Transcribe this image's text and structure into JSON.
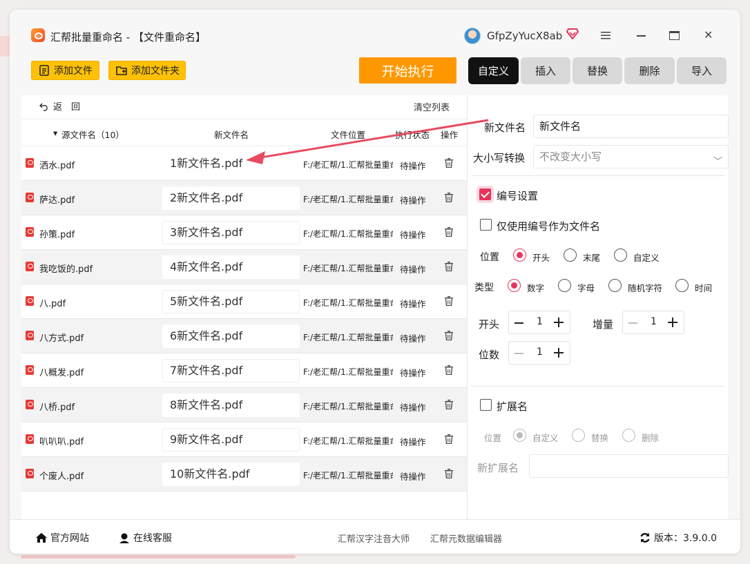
{
  "title": "汇帮批量重命名 - 【文件重命名】",
  "user": {
    "name": "GfpZyYucX8ab"
  },
  "toolbar": {
    "add_file": "添加文件",
    "add_folder": "添加文件夹",
    "start": "开始执行"
  },
  "tabs": [
    "自定义",
    "插入",
    "替换",
    "删除",
    "导入"
  ],
  "list": {
    "back": "返　回",
    "clear": "清空列表",
    "headers": {
      "source": "源文件名（10）",
      "new_name": "新文件名",
      "location": "文件位置",
      "status": "执行状态",
      "action": "操作"
    },
    "rows": [
      {
        "source": "洒水.pdf",
        "new_name": "1新文件名.pdf",
        "location": "F:/老汇帮/1.汇帮批量重命名",
        "status": "待操作"
      },
      {
        "source": "萨达.pdf",
        "new_name": "2新文件名.pdf",
        "location": "F:/老汇帮/1.汇帮批量重命名",
        "status": "待操作"
      },
      {
        "source": "孙策.pdf",
        "new_name": "3新文件名.pdf",
        "location": "F:/老汇帮/1.汇帮批量重命名",
        "status": "待操作"
      },
      {
        "source": "我吃饭的.pdf",
        "new_name": "4新文件名.pdf",
        "location": "F:/老汇帮/1.汇帮批量重命名",
        "status": "待操作"
      },
      {
        "source": "八.pdf",
        "new_name": "5新文件名.pdf",
        "location": "F:/老汇帮/1.汇帮批量重命名",
        "status": "待操作"
      },
      {
        "source": "八方式.pdf",
        "new_name": "6新文件名.pdf",
        "location": "F:/老汇帮/1.汇帮批量重命名",
        "status": "待操作"
      },
      {
        "source": "八概发.pdf",
        "new_name": "7新文件名.pdf",
        "location": "F:/老汇帮/1.汇帮批量重命名",
        "status": "待操作"
      },
      {
        "source": "八桥.pdf",
        "new_name": "8新文件名.pdf",
        "location": "F:/老汇帮/1.汇帮批量重命名",
        "status": "待操作"
      },
      {
        "source": "叭叭叭.pdf",
        "new_name": "9新文件名.pdf",
        "location": "F:/老汇帮/1.汇帮批量重命名",
        "status": "待操作"
      },
      {
        "source": "个废人.pdf",
        "new_name": "10新文件名.pdf",
        "location": "F:/老汇帮/1.汇帮批量重命名",
        "status": "待操作"
      }
    ]
  },
  "settings": {
    "new_name_label": "新文件名",
    "new_name_value": "新文件名",
    "case_label": "大小写转换",
    "case_value": "不改变大小写",
    "numbering_label": "编号设置",
    "numbering_checked": true,
    "only_number_label": "仅使用编号作为文件名",
    "only_number_checked": false,
    "position_label": "位置",
    "position_options": [
      "开头",
      "末尾",
      "自定义"
    ],
    "position_selected": 0,
    "type_label": "类型",
    "type_options": [
      "数字",
      "字母",
      "随机字符",
      "时间"
    ],
    "type_selected": 0,
    "start_label": "开头",
    "start_value": "1",
    "increment_label": "增量",
    "increment_value": "1",
    "digits_label": "位数",
    "digits_value": "1",
    "ext_label": "扩展名",
    "ext_checked": false,
    "ext_position_label": "位置",
    "ext_position_options": [
      "自定义",
      "替换",
      "删除"
    ],
    "ext_position_selected": 0,
    "new_ext_label": "新扩展名",
    "new_ext_value": ""
  },
  "footer": {
    "website": "官方网站",
    "support": "在线客服",
    "link1": "汇帮汉字注音大师",
    "link2": "汇帮元数据编辑器",
    "version": "版本：3.9.0.0"
  },
  "colors": {
    "accent": "#e8345c",
    "start_button": "#ff9800",
    "toolbar_button": "#ffc107",
    "annotation_arrow": "#e84a5f"
  }
}
